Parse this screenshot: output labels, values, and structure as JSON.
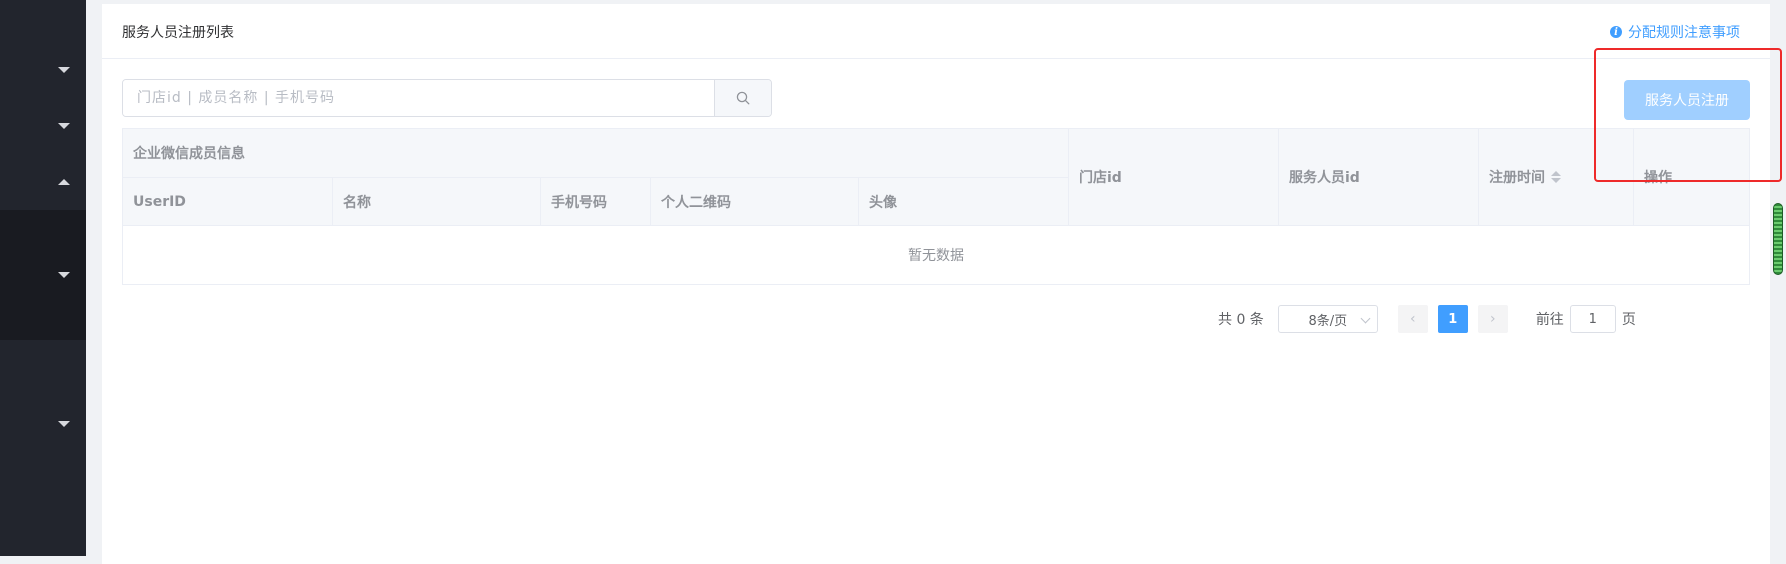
{
  "header": {
    "title": "服务人员注册列表",
    "rule_link": "分配规则注意事项",
    "info_glyph": "i"
  },
  "search": {
    "placeholder": "门店id | 成员名称 | 手机号码",
    "value": ""
  },
  "actions": {
    "register_label": "服务人员注册"
  },
  "table": {
    "group_header": "企业微信成员信息",
    "sub_columns": [
      "UserID",
      "名称",
      "手机号码",
      "个人二维码",
      "头像"
    ],
    "columns": [
      "门店id",
      "服务人员id",
      "注册时间",
      "操作"
    ],
    "empty_text": "暂无数据"
  },
  "pagination": {
    "total_text": "共 0 条",
    "page_size": "8条/页",
    "current_page": "1",
    "jump_label": "前往",
    "jump_value": "1",
    "page_unit": "页",
    "prev_glyph": "‹",
    "next_glyph": "›"
  },
  "colors": {
    "primary": "#409eff",
    "primary_disabled": "#a0cfff",
    "sidebar_bg": "#22252d",
    "highlight": "#ee2a2a"
  }
}
